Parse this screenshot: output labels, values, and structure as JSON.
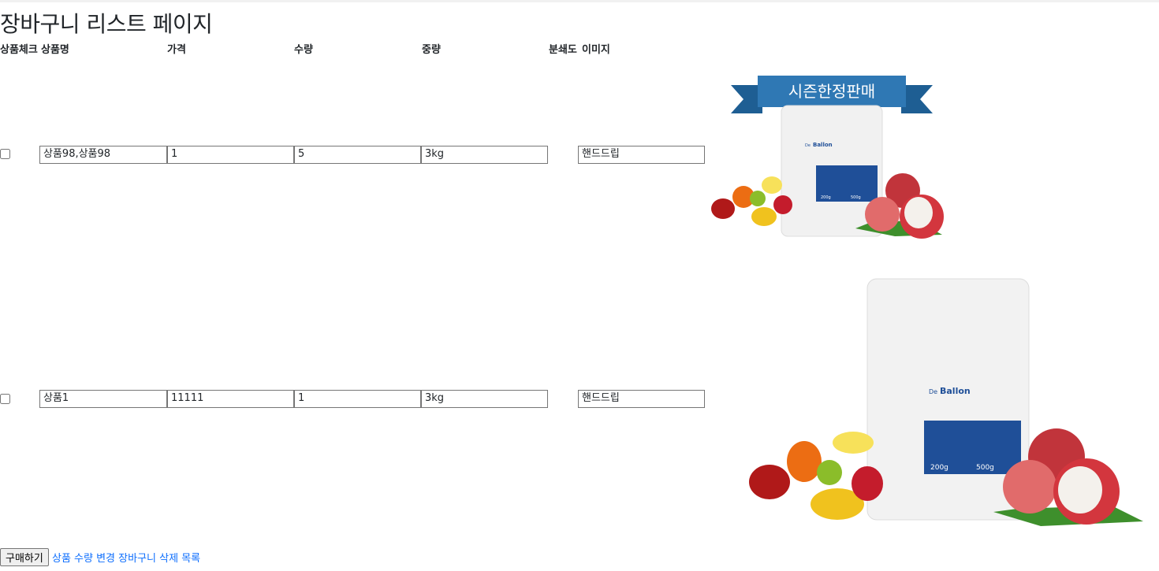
{
  "page": {
    "title": "장바구니 리스트 페이지"
  },
  "table": {
    "headers": [
      "상품체크",
      "상품명",
      "가격",
      "수량",
      "중량",
      "분쇄도",
      "이미지"
    ],
    "rows": [
      {
        "name": "상품98,상품98",
        "price": "1",
        "qty": "5",
        "weight": "3kg",
        "grind": "핸드드립",
        "image": {
          "banner": "시즌한정판매",
          "brand": "Ballon",
          "brand_prefix": "De",
          "size_small": "200g",
          "size_large": "500g"
        }
      },
      {
        "name": "상품1",
        "price": "11111",
        "qty": "1",
        "weight": "3kg",
        "grind": "핸드드립",
        "image": {
          "brand": "Ballon",
          "brand_prefix": "De",
          "size_small": "200g",
          "size_large": "500g"
        }
      }
    ]
  },
  "actions": {
    "buy_label": "구매하기",
    "change_qty_label": "상품 수량 변경",
    "delete_label": "장바구니 삭제",
    "list_label": "목록"
  },
  "colors": {
    "link": "#0d6efd",
    "banner": "#2f78b4",
    "pouch_label": "#1f4f98"
  }
}
